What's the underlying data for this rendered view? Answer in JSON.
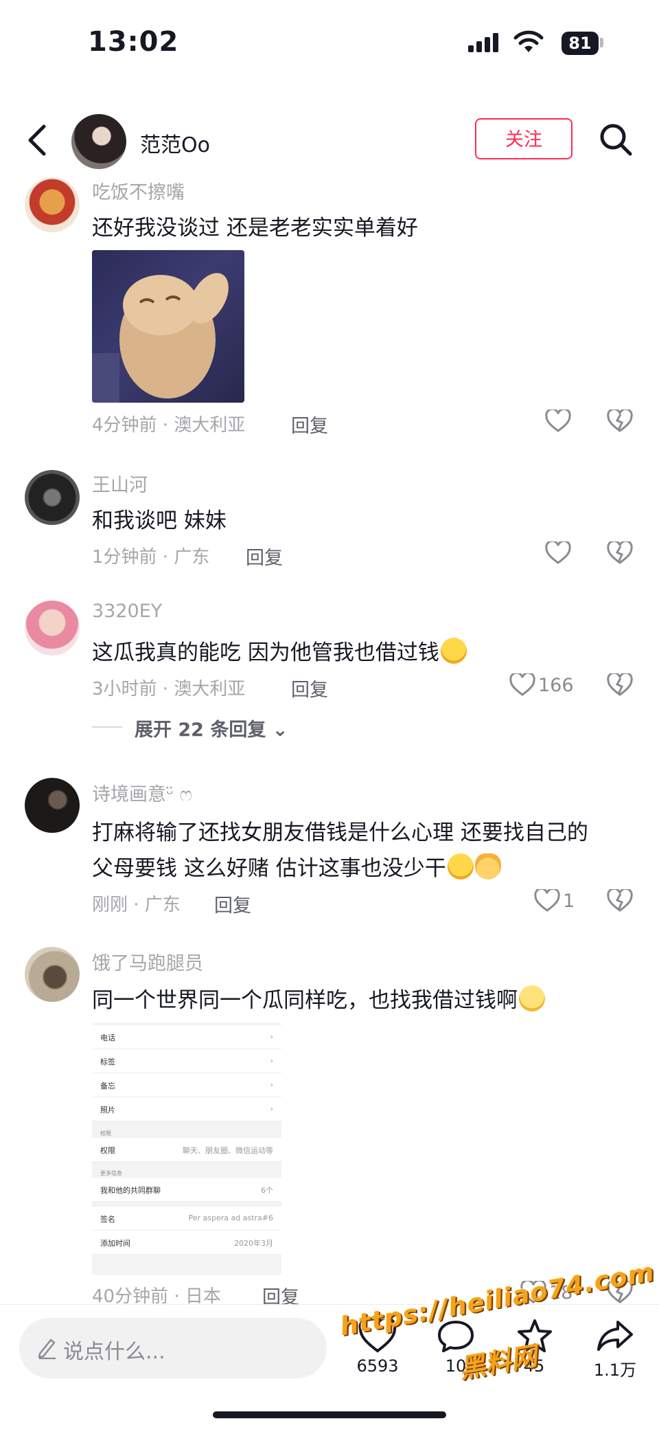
{
  "status_bar": {
    "time": "13:02",
    "battery": "81"
  },
  "header": {
    "title": "范范Oo",
    "follow_label": "关注"
  },
  "comments": [
    {
      "username": "吃饭不擦嘴",
      "text": "还好我没谈过 还是老老实实单着好",
      "time_location": "4分钟前 · 澳大利亚",
      "reply": "回复",
      "likes": ""
    },
    {
      "username": "王山河",
      "text": "和我谈吧 妹妹",
      "time_location": "1分钟前 · 广东",
      "reply": "回复",
      "likes": ""
    },
    {
      "username": "3320EY",
      "text": "这瓜我真的能吃 因为他管我也借过钱",
      "time_location": "3小时前 · 澳大利亚",
      "reply": "回复",
      "likes": "166",
      "expand": "展开 22 条回复"
    },
    {
      "username": "诗境画意ᵕ̈ ෆ",
      "text_line1": "打麻将输了还找女朋友借钱是什么心理 还要找自己的",
      "text_line2": "父母要钱  这么好赌 估计这事也没少干",
      "time_location": "刚刚 · 广东",
      "reply": "回复",
      "likes": "1"
    },
    {
      "username": "饿了马跑腿员",
      "text": "同一个世界同一个瓜同样吃，也找我借过钱啊",
      "time_location": "40分钟前 · 日本",
      "reply": "回复",
      "likes": "18"
    }
  ],
  "screenshot_rows": {
    "phone": "电话",
    "tag": "标签",
    "note": "备忘",
    "photos": "照片",
    "perm_section": "权限",
    "perm": "权限",
    "perm_value": "聊天、朋友圈、微信运动等",
    "more_section": "更多信息",
    "groups": "我和他的共同群聊",
    "groups_value": "6个",
    "signature": "签名",
    "signature_value": "Per aspera ad astra#6",
    "added": "添加时间",
    "added_value": "2020年3月"
  },
  "bottom_bar": {
    "input_placeholder": "说点什么...",
    "like_count": "6593",
    "comment_count": "10",
    "favorite_count": "45",
    "share_count": "1.1万"
  },
  "watermark": {
    "line1": "https://heiliao74.com",
    "line2": "黑料网"
  },
  "colors": {
    "accent": "#fe2c55",
    "text": "#161823",
    "secondary": "#a5a6ab",
    "watermark": "#f6a21b"
  }
}
